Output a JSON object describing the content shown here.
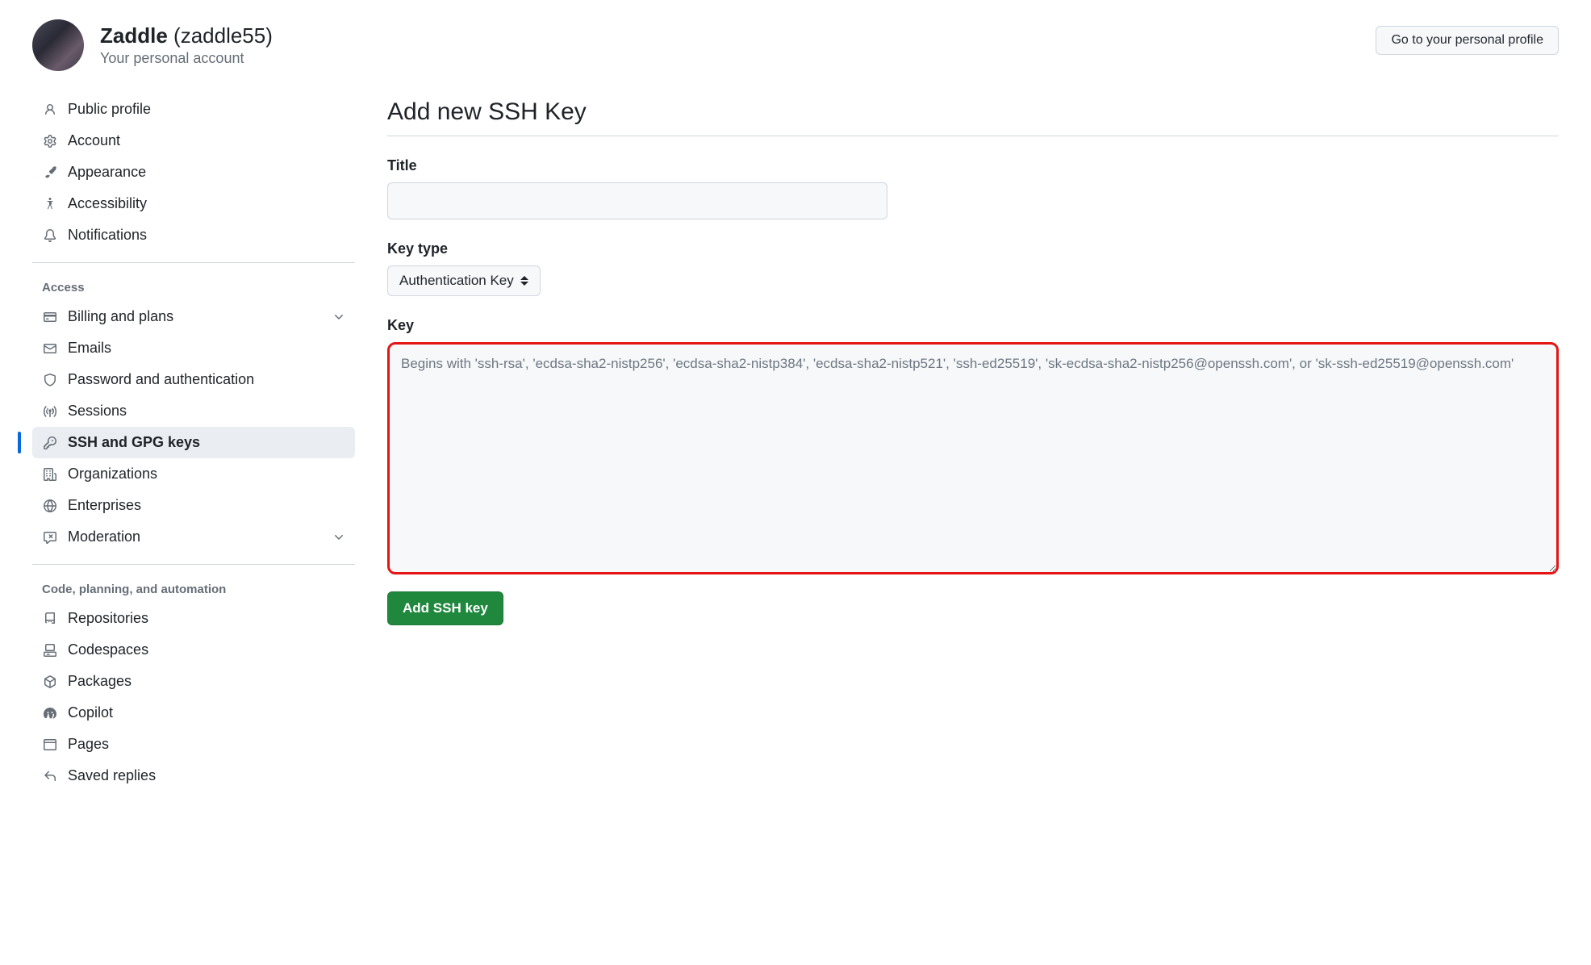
{
  "header": {
    "display_name": "Zaddle",
    "username": "(zaddle55)",
    "subtitle": "Your personal account",
    "go_profile_btn": "Go to your personal profile"
  },
  "sidebar": {
    "items_top": [
      {
        "icon": "person",
        "label": "Public profile"
      },
      {
        "icon": "gear",
        "label": "Account"
      },
      {
        "icon": "brush",
        "label": "Appearance"
      },
      {
        "icon": "accessibility",
        "label": "Accessibility"
      },
      {
        "icon": "bell",
        "label": "Notifications"
      }
    ],
    "group_access": {
      "title": "Access",
      "items": [
        {
          "icon": "credit-card",
          "label": "Billing and plans",
          "expandable": true
        },
        {
          "icon": "mail",
          "label": "Emails"
        },
        {
          "icon": "shield",
          "label": "Password and authentication"
        },
        {
          "icon": "broadcast",
          "label": "Sessions"
        },
        {
          "icon": "key",
          "label": "SSH and GPG keys",
          "active": true
        },
        {
          "icon": "org",
          "label": "Organizations"
        },
        {
          "icon": "globe",
          "label": "Enterprises"
        },
        {
          "icon": "report",
          "label": "Moderation",
          "expandable": true
        }
      ]
    },
    "group_code": {
      "title": "Code, planning, and automation",
      "items": [
        {
          "icon": "repo",
          "label": "Repositories"
        },
        {
          "icon": "codespaces",
          "label": "Codespaces"
        },
        {
          "icon": "package",
          "label": "Packages"
        },
        {
          "icon": "copilot",
          "label": "Copilot"
        },
        {
          "icon": "browser",
          "label": "Pages"
        },
        {
          "icon": "reply",
          "label": "Saved replies"
        }
      ]
    }
  },
  "main": {
    "page_title": "Add new SSH Key",
    "title_label": "Title",
    "keytype_label": "Key type",
    "keytype_selected": "Authentication Key",
    "key_label": "Key",
    "key_placeholder": "Begins with 'ssh-rsa', 'ecdsa-sha2-nistp256', 'ecdsa-sha2-nistp384', 'ecdsa-sha2-nistp521', 'ssh-ed25519', 'sk-ecdsa-sha2-nistp256@openssh.com', or 'sk-ssh-ed25519@openssh.com'",
    "submit_label": "Add SSH key"
  }
}
